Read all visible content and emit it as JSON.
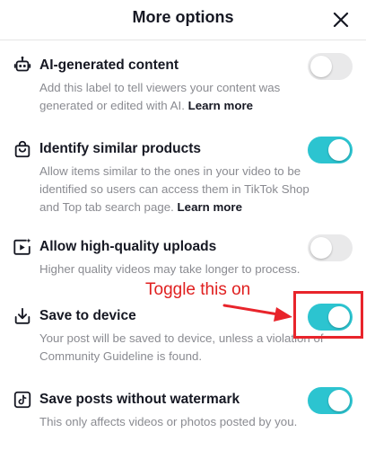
{
  "header": {
    "title": "More options",
    "close_icon": "close-icon"
  },
  "colors": {
    "toggle_on": "#2cc4d0",
    "toggle_off": "#e9e9ea",
    "annotation": "#e02020"
  },
  "options": [
    {
      "title": "AI-generated content",
      "desc": "Add this label to tell viewers your content was generated or edited with AI.",
      "link": "Learn more",
      "icon": "robot-icon",
      "enabled": false
    },
    {
      "title": "Identify similar products",
      "desc": "Allow items similar to the ones in your video to be identified so users can access them in TikTok Shop and Top tab search page.",
      "link": "Learn more",
      "icon": "shopping-bag-icon",
      "enabled": true
    },
    {
      "title": "Allow high-quality uploads",
      "desc": "Higher quality videos may take longer to process.",
      "link": "",
      "icon": "hd-video-icon",
      "enabled": false
    },
    {
      "title": "Save to device",
      "desc": "Your post will be saved to device, unless a violation of Community Guideline is found.",
      "link": "",
      "icon": "download-icon",
      "enabled": true
    },
    {
      "title": "Save posts without watermark",
      "desc": "This only affects videos or photos posted by you.",
      "link": "",
      "icon": "tiktok-note-icon",
      "enabled": true
    }
  ],
  "annotation": {
    "text": "Toggle this on"
  }
}
